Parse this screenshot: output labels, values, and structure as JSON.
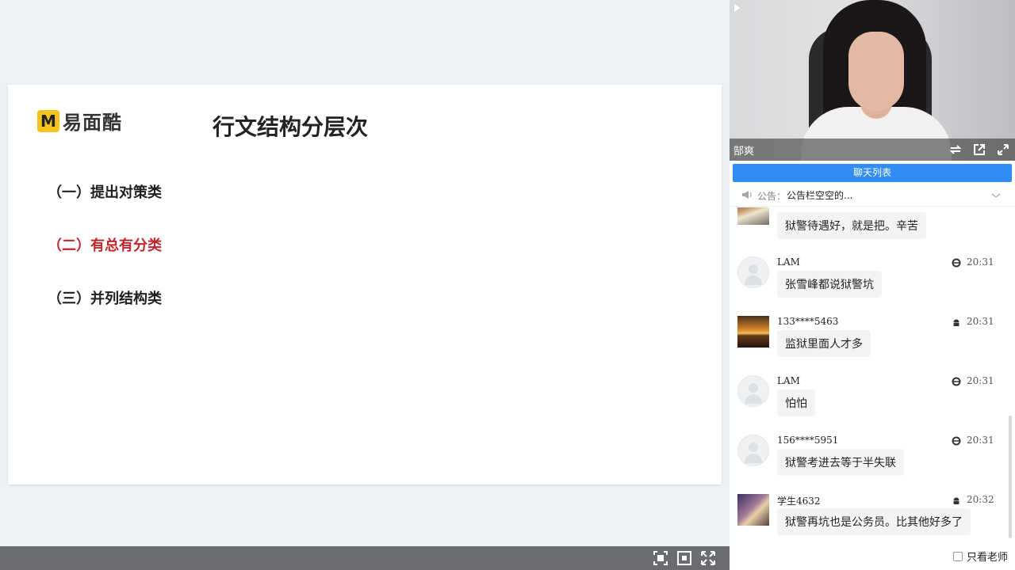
{
  "slide": {
    "logo_mark": "M",
    "logo_text": "易面酷",
    "title": "行文结构分层次",
    "items": [
      {
        "label": "（一）提出对策类",
        "active": false
      },
      {
        "label": "（二）有总有分类",
        "active": true
      },
      {
        "label": "（三）并列结构类",
        "active": false
      }
    ]
  },
  "toolbar": {
    "icons": [
      "fit-screen-icon",
      "focus-icon",
      "fullscreen-icon"
    ]
  },
  "video": {
    "teacher_name": "郜爽",
    "icons": [
      "switch-icon",
      "popout-icon",
      "expand-icon"
    ]
  },
  "chat": {
    "tab_label": "聊天列表",
    "notice_label": "公告：",
    "notice_text": "公告栏空空的...",
    "messages": [
      {
        "username": "",
        "device": "",
        "time": "",
        "text": "狱警待遇好，就是把。辛苦",
        "avatar": "cloud"
      },
      {
        "username": "LAM",
        "device": "ie-icon",
        "time": "20:31",
        "text": "张雪峰都说狱警坑",
        "avatar": "default"
      },
      {
        "username": "133****5463",
        "device": "android-icon",
        "time": "20:31",
        "text": "监狱里面人才多",
        "avatar": "sunset"
      },
      {
        "username": "LAM",
        "device": "ie-icon",
        "time": "20:31",
        "text": "怕怕",
        "avatar": "default"
      },
      {
        "username": "156****5951",
        "device": "ie-icon",
        "time": "20:31",
        "text": "狱警考进去等于半失联",
        "avatar": "default"
      },
      {
        "username": "学生4632",
        "device": "android-icon",
        "time": "20:32",
        "text": "狱警再坑也是公务员。比其他好多了",
        "avatar": "sky"
      }
    ],
    "only_teacher_label": "只看老师"
  },
  "colors": {
    "accent_blue": "#2f8df4",
    "active_red": "#c0272d",
    "logo_yellow": "#f6c31c",
    "toolbar_gray": "#6a6c70"
  }
}
